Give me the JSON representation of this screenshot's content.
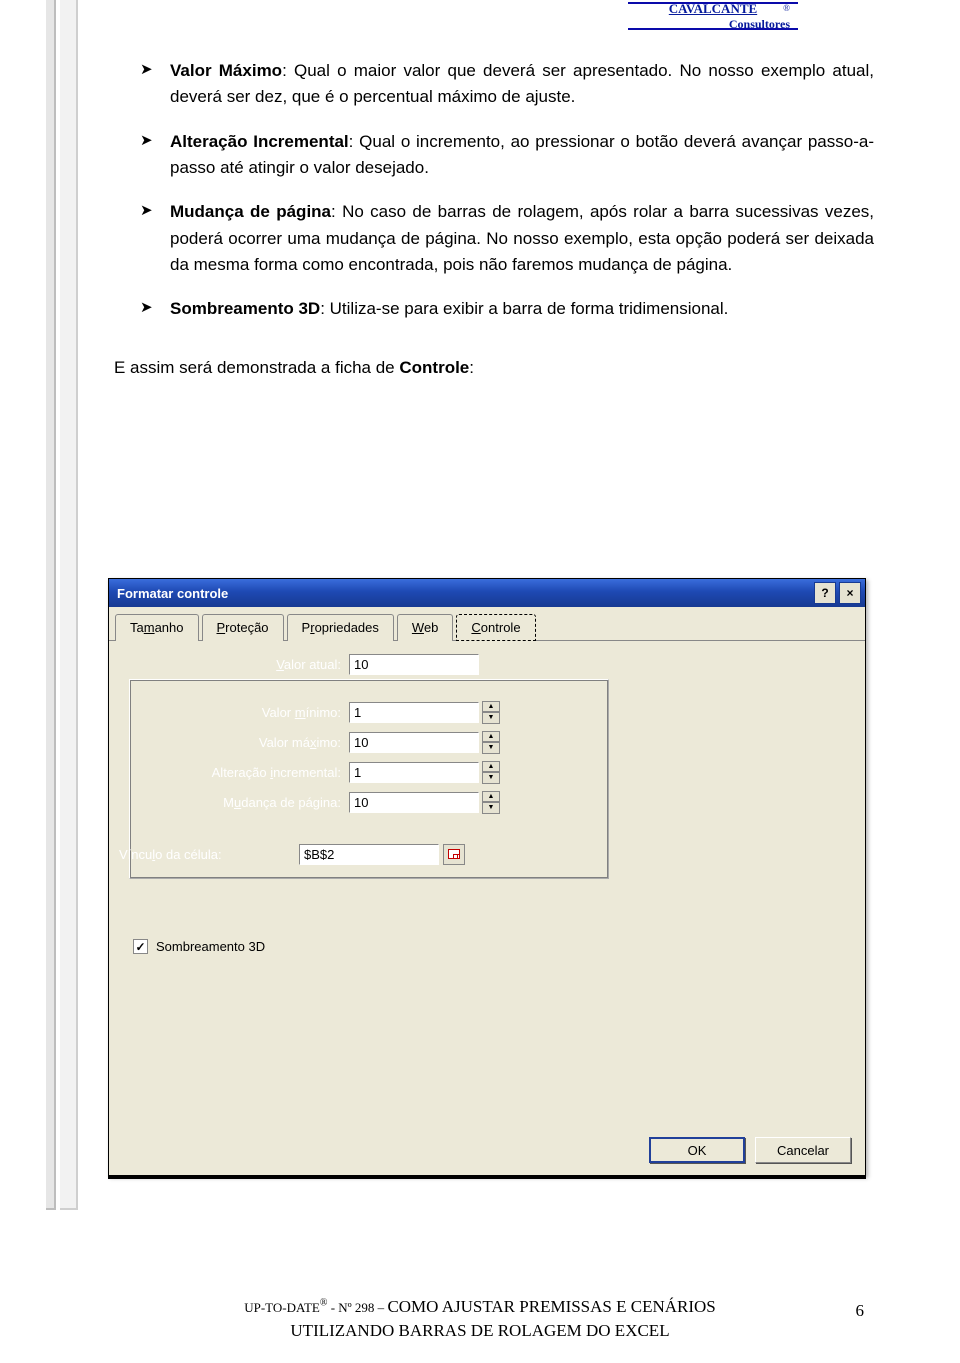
{
  "brand": {
    "line1": "CAVALCANTE",
    "line2": "Consultores",
    "reg": "®"
  },
  "bullets": [
    {
      "term": "Valor Máximo",
      "text": ": Qual o maior valor que deverá ser apresentado. No nosso exemplo atual, deverá ser dez, que é o percentual máximo de ajuste."
    },
    {
      "term": "Alteração Incremental",
      "text": ": Qual o incremento, ao pressionar o botão deverá avançar passo-a-passo até atingir o valor desejado."
    },
    {
      "term": "Mudança de página",
      "text": ": No caso de barras de rolagem, após rolar a barra sucessivas vezes, poderá ocorrer uma mudança de página. No nosso exemplo, esta opção poderá ser deixada da mesma forma como encontrada, pois não faremos mudança de página."
    },
    {
      "term": "Sombreamento 3D",
      "text": ": Utiliza-se para exibir a barra de forma tridimensional."
    }
  ],
  "postlist": "E assim será demonstrada a ficha de Controle:",
  "postlist_bold": "Controle",
  "dialog": {
    "title": "Formatar controle",
    "help": "?",
    "close": "×",
    "tabs": [
      {
        "pre": "Ta",
        "ul": "m",
        "post": "anho"
      },
      {
        "pre": "",
        "ul": "P",
        "post": "roteção"
      },
      {
        "pre": "P",
        "ul": "r",
        "post": "opriedades"
      },
      {
        "pre": "",
        "ul": "W",
        "post": "eb"
      },
      {
        "pre": "",
        "ul": "C",
        "post": "ontrole"
      }
    ],
    "active_tab": 4,
    "fields": {
      "valor_atual": {
        "label_pre": "",
        "label_ul": "V",
        "label_post": "alor atual:",
        "value": "10",
        "spin": false
      },
      "valor_minimo": {
        "label_pre": "Valor ",
        "label_ul": "m",
        "label_post": "ínimo:",
        "value": "1",
        "spin": true
      },
      "valor_maximo": {
        "label_pre": "Valor má",
        "label_ul": "x",
        "label_post": "imo:",
        "value": "10",
        "spin": true
      },
      "alteracao": {
        "label_pre": "Alteração ",
        "label_ul": "i",
        "label_post": "ncremental:",
        "value": "1",
        "spin": true
      },
      "mudanca": {
        "label_pre": "M",
        "label_ul": "u",
        "label_post": "dança de página:",
        "value": "10",
        "spin": true
      },
      "vinculo": {
        "label_pre": "Víncu",
        "label_ul": "l",
        "label_post": "o da célula:",
        "value": "$B$2"
      }
    },
    "checkbox": {
      "label": "Sombreamento 3",
      "ul": "D",
      "checked": "✓"
    },
    "buttons": {
      "ok": "OK",
      "cancel": "Cancelar"
    }
  },
  "footer": {
    "line1_a": "UP-TO-DATE",
    "line1_reg": "®",
    "line1_b": " - Nº 298 – ",
    "line1_c": "COMO AJUSTAR PREMISSAS E CENÁRIOS",
    "line2": "UTILIZANDO BARRAS DE ROLAGEM DO EXCEL",
    "page": "6"
  }
}
